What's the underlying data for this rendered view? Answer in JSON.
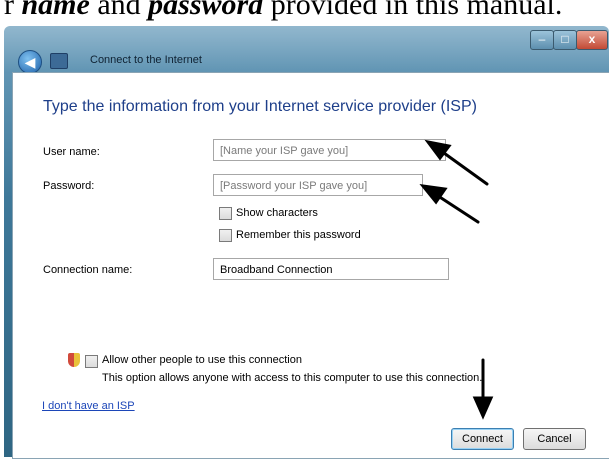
{
  "document_text": {
    "prefix": "r ",
    "name_word": "name",
    "and_word": " and ",
    "password_word": "password",
    "suffix": " provided in this manual."
  },
  "window": {
    "title": "Connect to the Internet",
    "controls": {
      "minimize": "–",
      "maximize": "□",
      "close": "x"
    }
  },
  "form": {
    "heading": "Type the information from your Internet service provider (ISP)",
    "username_label": "User name:",
    "username_placeholder": "[Name your ISP gave you]",
    "password_label": "Password:",
    "password_placeholder": "[Password your ISP gave you]",
    "show_characters_label": "Show characters",
    "remember_password_label": "Remember this password",
    "connection_name_label": "Connection name:",
    "connection_name_value": "Broadband Connection",
    "allow_others_label": "Allow other people to use this connection",
    "allow_others_desc": "This option allows anyone with access to this computer to use this connection.",
    "no_isp_link": "I don't have an ISP"
  },
  "buttons": {
    "connect": "Connect",
    "cancel": "Cancel"
  },
  "icons": {
    "back": "back-arrow-icon",
    "network": "network-icon",
    "shield": "uac-shield-icon"
  }
}
